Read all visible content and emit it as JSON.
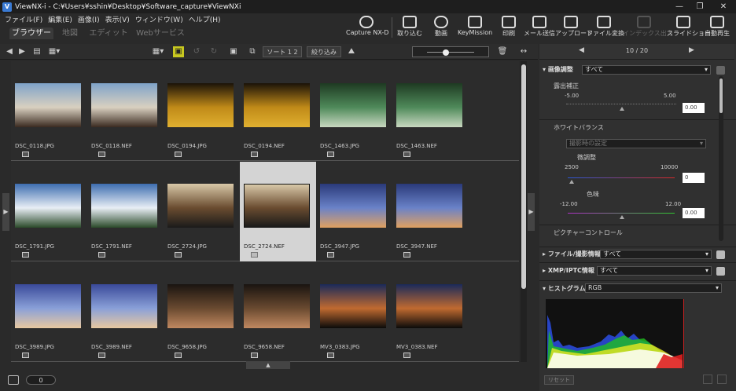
{
  "window": {
    "title": "ViewNX-i - C:¥Users¥sshin¥Desktop¥Software_capture¥ViewNXi",
    "app_icon": "V",
    "controls": [
      "—",
      "❐",
      "✕"
    ]
  },
  "menu": [
    "ファイル(F)",
    "編集(E)",
    "画像(I)",
    "表示(V)",
    "ウィンドウ(W)",
    "ヘルプ(H)"
  ],
  "tabs": [
    {
      "label": "ブラウザー",
      "active": true
    },
    {
      "label": "地図",
      "active": false
    },
    {
      "label": "エディット",
      "active": false
    },
    {
      "label": "Webサービス",
      "active": false
    }
  ],
  "toolbar": {
    "capture_nxd": "Capture NX-D",
    "buttons": [
      {
        "label": "取り込む",
        "icon": "import-icon",
        "disabled": false
      },
      {
        "label": "動画",
        "icon": "movie-icon",
        "disabled": false
      },
      {
        "label": "KeyMission",
        "icon": "keymission-icon",
        "disabled": false
      },
      {
        "label": "印刷",
        "icon": "print-icon",
        "disabled": false
      },
      {
        "label": "メール送信",
        "icon": "mail-icon",
        "disabled": false
      },
      {
        "label": "アップロード",
        "icon": "upload-icon",
        "disabled": false
      },
      {
        "label": "ファイル変換",
        "icon": "convert-icon",
        "disabled": false
      },
      {
        "label": "インデックス出力",
        "icon": "index-print-icon",
        "disabled": true
      },
      {
        "label": "スライドショー",
        "icon": "slideshow-icon",
        "disabled": false
      },
      {
        "label": "自動再生",
        "icon": "autoplay-icon",
        "disabled": false
      }
    ]
  },
  "subbar": {
    "sort_label": "ソート",
    "sort_badge": "1 2",
    "filter_label": "絞り込み"
  },
  "thumbnails": [
    [
      {
        "name": "DSC_0118.JPG",
        "colors": [
          "#7fa3c9",
          "#d9d0c0",
          "#3a2a20"
        ]
      },
      {
        "name": "DSC_0118.NEF",
        "colors": [
          "#7fa3c9",
          "#d9d0c0",
          "#3a2a20"
        ]
      },
      {
        "name": "DSC_0194.JPG",
        "colors": [
          "#1a1208",
          "#c08a18",
          "#e0b030"
        ]
      },
      {
        "name": "DSC_0194.NEF",
        "colors": [
          "#1a1208",
          "#c08a18",
          "#e0b030"
        ]
      },
      {
        "name": "DSC_1463.JPG",
        "colors": [
          "#1e3a22",
          "#4f8a5a",
          "#c8d8c0"
        ]
      },
      {
        "name": "DSC_1463.NEF",
        "colors": [
          "#1e3a22",
          "#4f8a5a",
          "#c8d8c0"
        ]
      }
    ],
    [
      {
        "name": "DSC_1791.JPG",
        "colors": [
          "#3d6db0",
          "#e8eef5",
          "#2b4a2a"
        ]
      },
      {
        "name": "DSC_1791.NEF",
        "colors": [
          "#3d6db0",
          "#e8eef5",
          "#2b4a2a"
        ]
      },
      {
        "name": "DSC_2724.JPG",
        "colors": [
          "#d8c8a8",
          "#6a4c30",
          "#1a1a1a"
        ]
      },
      {
        "name": "DSC_2724.NEF",
        "colors": [
          "#d8c8a8",
          "#6a4c30",
          "#1a1a1a"
        ],
        "selected": true
      },
      {
        "name": "DSC_3947.JPG",
        "colors": [
          "#2a3a7a",
          "#6a82c8",
          "#e0a060"
        ]
      },
      {
        "name": "DSC_3947.NEF",
        "colors": [
          "#2a3a7a",
          "#6a82c8",
          "#e0a060"
        ]
      }
    ],
    [
      {
        "name": "DSC_3989.JPG",
        "colors": [
          "#3a4a9a",
          "#8aa0d8",
          "#e8c8a0"
        ]
      },
      {
        "name": "DSC_3989.NEF",
        "colors": [
          "#3a4a9a",
          "#8aa0d8",
          "#e8c8a0"
        ]
      },
      {
        "name": "DSC_9658.JPG",
        "colors": [
          "#1a1410",
          "#6a4a30",
          "#c08860"
        ]
      },
      {
        "name": "DSC_9658.NEF",
        "colors": [
          "#1a1410",
          "#6a4a30",
          "#c08860"
        ]
      },
      {
        "name": "MV3_0383.JPG",
        "colors": [
          "#1a2a5a",
          "#c06a30",
          "#0a0a0a"
        ]
      },
      {
        "name": "MV3_0383.NEF",
        "colors": [
          "#1a2a5a",
          "#c06a30",
          "#0a0a0a"
        ]
      }
    ]
  ],
  "status": {
    "count": "0"
  },
  "right": {
    "nav_count": "10 / 20",
    "adjust_label": "画像調整",
    "adjust_filter": "すべて",
    "exposure": {
      "label": "露出補正",
      "min": "-5.00",
      "max": "5.00",
      "value": "0.00"
    },
    "wb": {
      "label": "ホワイトバランス",
      "preset": "撮影時の設定",
      "fine_label": "微調整",
      "temp_min": "2500",
      "temp_max": "10000",
      "temp_value": "0",
      "tint_label": "色味",
      "tint_min": "-12.00",
      "tint_max": "12.00",
      "tint_value": "0.00"
    },
    "picture_control": "ピクチャーコントロール",
    "file_info_label": "ファイル/撮影情報",
    "file_info_filter": "すべて",
    "xmp_label": "XMP/IPTC情報",
    "xmp_filter": "すべて",
    "histogram_label": "ヒストグラム",
    "histogram_mode": "RGB",
    "reset_label": "リセット"
  }
}
